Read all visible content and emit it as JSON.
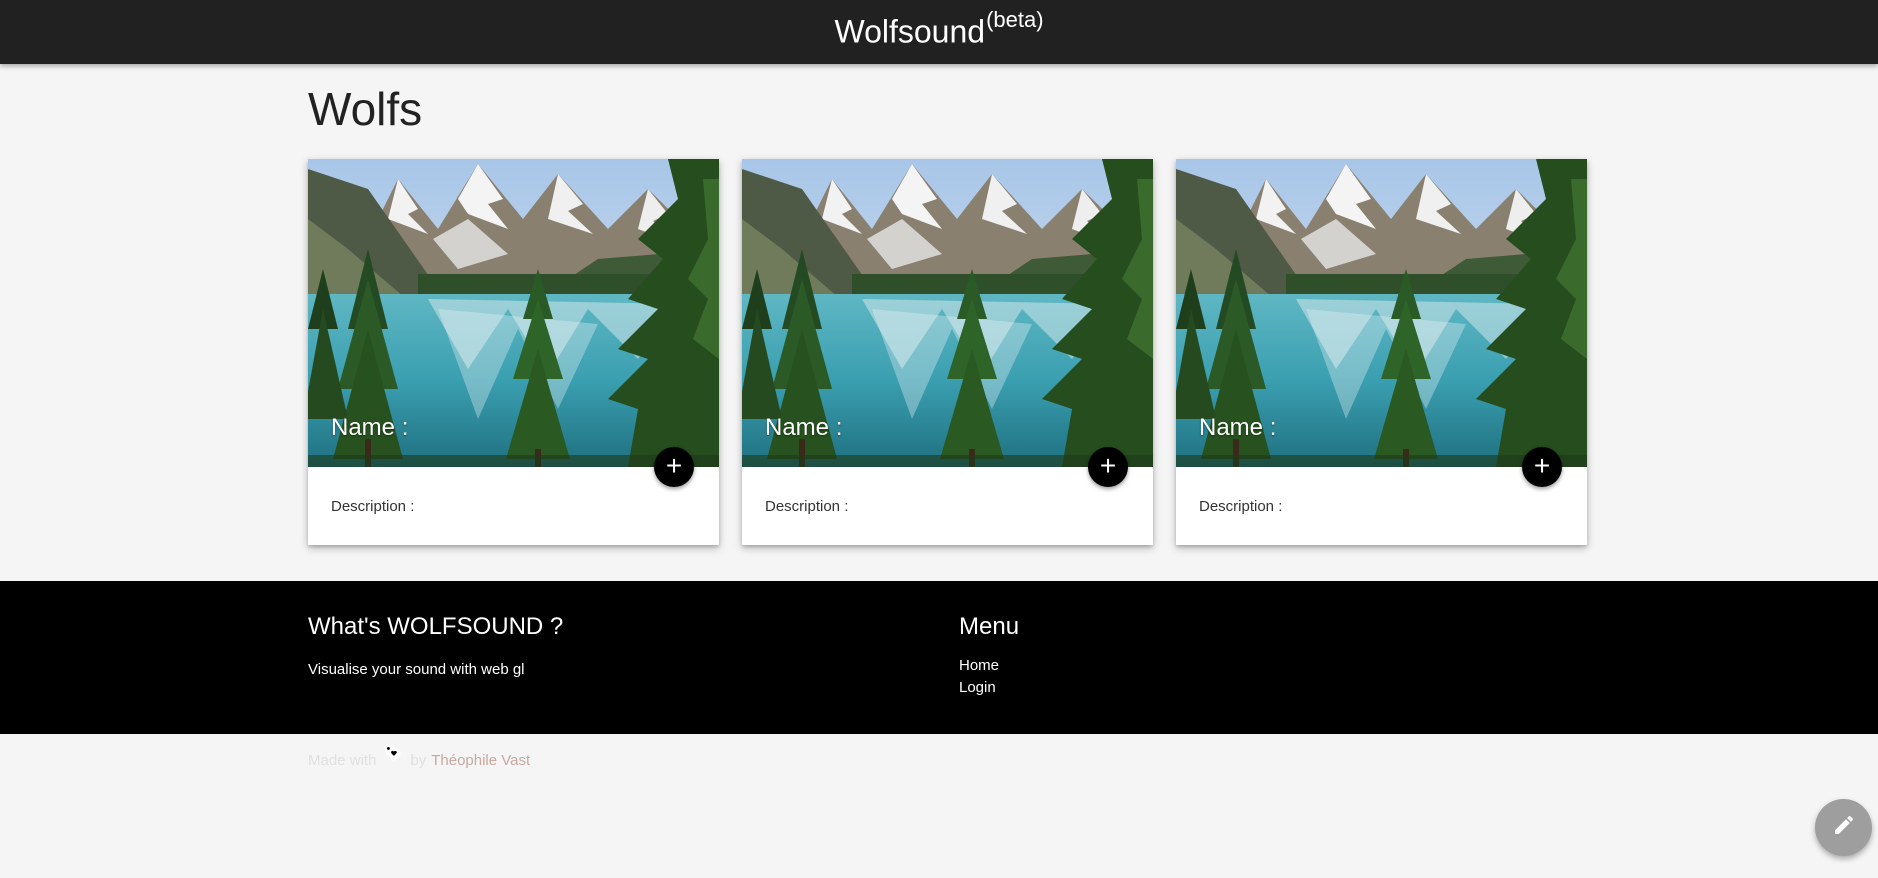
{
  "nav": {
    "brand": "Wolfsound",
    "brand_sup": "(beta)"
  },
  "page": {
    "title": "Wolfs"
  },
  "cards": [
    {
      "title": "Name :",
      "description": "Description :",
      "action_label": "+"
    },
    {
      "title": "Name :",
      "description": "Description :",
      "action_label": "+"
    },
    {
      "title": "Name :",
      "description": "Description :",
      "action_label": "+"
    }
  ],
  "footer": {
    "about_title": "What's WOLFSOUND ?",
    "about_text": "Visualise your sound with web gl",
    "menu_title": "Menu",
    "menu_items": [
      "Home",
      "Login"
    ],
    "made_with": "Made with",
    "by": "by",
    "author": "Théophile Vast"
  },
  "colors": {
    "navbar": "#212121",
    "background": "#f5f5f5",
    "footer": "#000000",
    "author_link": "#c8a9a1",
    "fab": "#9e9e9e"
  },
  "icons": {
    "card_action": "plus-icon",
    "made_with": "tag-heart-icon",
    "fab": "pencil-icon"
  }
}
